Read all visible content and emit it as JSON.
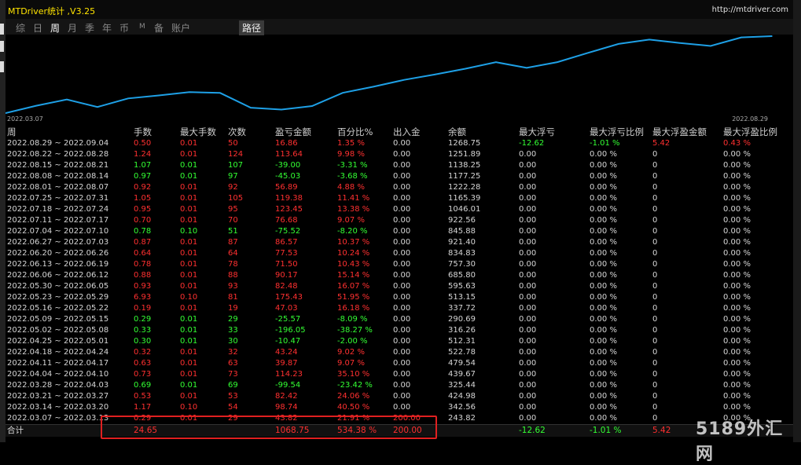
{
  "window": {
    "title": "MTDriver统计 ,V3.25",
    "url": "http://mtdriver.com"
  },
  "toolbar": {
    "tabs": [
      "综",
      "日",
      "周",
      "月",
      "季",
      "年",
      "币",
      "M",
      "备",
      "账户"
    ],
    "active": "周",
    "path_label": "路径"
  },
  "chart_data": {
    "type": "line",
    "x_start_label": "2022.03.07",
    "x_end_label": "2022.08.29",
    "categories": [
      "2022.03.07",
      "2022.03.14",
      "2022.03.21",
      "2022.03.28",
      "2022.04.04",
      "2022.04.11",
      "2022.04.18",
      "2022.04.25",
      "2022.05.02",
      "2022.05.09",
      "2022.05.16",
      "2022.05.23",
      "2022.05.30",
      "2022.06.06",
      "2022.06.13",
      "2022.06.20",
      "2022.06.27",
      "2022.07.04",
      "2022.07.11",
      "2022.07.18",
      "2022.07.25",
      "2022.08.01",
      "2022.08.08",
      "2022.08.15",
      "2022.08.22",
      "2022.08.29"
    ],
    "values": [
      243.82,
      342.56,
      424.98,
      325.44,
      439.67,
      479.54,
      522.78,
      512.31,
      316.26,
      290.69,
      337.72,
      513.15,
      595.63,
      685.8,
      757.3,
      834.83,
      921.4,
      845.88,
      922.56,
      1046.01,
      1165.39,
      1222.28,
      1177.25,
      1138.25,
      1251.89,
      1268.75
    ],
    "line_color": "#1ea0e6"
  },
  "table": {
    "headers": [
      "周",
      "手数",
      "最大手数",
      "次数",
      "盈亏金额",
      "百分比%",
      "出入金",
      "余额",
      "最大浮亏",
      "最大浮亏比例",
      "最大浮盈金额",
      "最大浮盈比例"
    ],
    "rows": [
      {
        "d": "2022.08.29 ~ 2022.09.04",
        "lots": "0.50",
        "maxlot": "0.01",
        "cnt": "50",
        "pl": "16.86",
        "pct": "1.35 %",
        "io": "0.00",
        "bal": "1268.75",
        "mdd": "-12.62",
        "mddp": "-1.01 %",
        "mfe": "5.42",
        "mfep": "0.43 %",
        "t": "p"
      },
      {
        "d": "2022.08.22 ~ 2022.08.28",
        "lots": "1.24",
        "maxlot": "0.01",
        "cnt": "124",
        "pl": "113.64",
        "pct": "9.98 %",
        "io": "0.00",
        "bal": "1251.89",
        "mdd": "0.00",
        "mddp": "0.00 %",
        "mfe": "0",
        "mfep": "0.00 %",
        "t": "p"
      },
      {
        "d": "2022.08.15 ~ 2022.08.21",
        "lots": "1.07",
        "maxlot": "0.01",
        "cnt": "107",
        "pl": "-39.00",
        "pct": "-3.31 %",
        "io": "0.00",
        "bal": "1138.25",
        "mdd": "0.00",
        "mddp": "0.00 %",
        "mfe": "0",
        "mfep": "0.00 %",
        "t": "n"
      },
      {
        "d": "2022.08.08 ~ 2022.08.14",
        "lots": "0.97",
        "maxlot": "0.01",
        "cnt": "97",
        "pl": "-45.03",
        "pct": "-3.68 %",
        "io": "0.00",
        "bal": "1177.25",
        "mdd": "0.00",
        "mddp": "0.00 %",
        "mfe": "0",
        "mfep": "0.00 %",
        "t": "n"
      },
      {
        "d": "2022.08.01 ~ 2022.08.07",
        "lots": "0.92",
        "maxlot": "0.01",
        "cnt": "92",
        "pl": "56.89",
        "pct": "4.88 %",
        "io": "0.00",
        "bal": "1222.28",
        "mdd": "0.00",
        "mddp": "0.00 %",
        "mfe": "0",
        "mfep": "0.00 %",
        "t": "p"
      },
      {
        "d": "2022.07.25 ~ 2022.07.31",
        "lots": "1.05",
        "maxlot": "0.01",
        "cnt": "105",
        "pl": "119.38",
        "pct": "11.41 %",
        "io": "0.00",
        "bal": "1165.39",
        "mdd": "0.00",
        "mddp": "0.00 %",
        "mfe": "0",
        "mfep": "0.00 %",
        "t": "p"
      },
      {
        "d": "2022.07.18 ~ 2022.07.24",
        "lots": "0.95",
        "maxlot": "0.01",
        "cnt": "95",
        "pl": "123.45",
        "pct": "13.38 %",
        "io": "0.00",
        "bal": "1046.01",
        "mdd": "0.00",
        "mddp": "0.00 %",
        "mfe": "0",
        "mfep": "0.00 %",
        "t": "p"
      },
      {
        "d": "2022.07.11 ~ 2022.07.17",
        "lots": "0.70",
        "maxlot": "0.01",
        "cnt": "70",
        "pl": "76.68",
        "pct": "9.07 %",
        "io": "0.00",
        "bal": "922.56",
        "mdd": "0.00",
        "mddp": "0.00 %",
        "mfe": "0",
        "mfep": "0.00 %",
        "t": "p"
      },
      {
        "d": "2022.07.04 ~ 2022.07.10",
        "lots": "0.78",
        "maxlot": "0.10",
        "cnt": "51",
        "pl": "-75.52",
        "pct": "-8.20 %",
        "io": "0.00",
        "bal": "845.88",
        "mdd": "0.00",
        "mddp": "0.00 %",
        "mfe": "0",
        "mfep": "0.00 %",
        "t": "n"
      },
      {
        "d": "2022.06.27 ~ 2022.07.03",
        "lots": "0.87",
        "maxlot": "0.01",
        "cnt": "87",
        "pl": "86.57",
        "pct": "10.37 %",
        "io": "0.00",
        "bal": "921.40",
        "mdd": "0.00",
        "mddp": "0.00 %",
        "mfe": "0",
        "mfep": "0.00 %",
        "t": "p"
      },
      {
        "d": "2022.06.20 ~ 2022.06.26",
        "lots": "0.64",
        "maxlot": "0.01",
        "cnt": "64",
        "pl": "77.53",
        "pct": "10.24 %",
        "io": "0.00",
        "bal": "834.83",
        "mdd": "0.00",
        "mddp": "0.00 %",
        "mfe": "0",
        "mfep": "0.00 %",
        "t": "p"
      },
      {
        "d": "2022.06.13 ~ 2022.06.19",
        "lots": "0.78",
        "maxlot": "0.01",
        "cnt": "78",
        "pl": "71.50",
        "pct": "10.43 %",
        "io": "0.00",
        "bal": "757.30",
        "mdd": "0.00",
        "mddp": "0.00 %",
        "mfe": "0",
        "mfep": "0.00 %",
        "t": "p"
      },
      {
        "d": "2022.06.06 ~ 2022.06.12",
        "lots": "0.88",
        "maxlot": "0.01",
        "cnt": "88",
        "pl": "90.17",
        "pct": "15.14 %",
        "io": "0.00",
        "bal": "685.80",
        "mdd": "0.00",
        "mddp": "0.00 %",
        "mfe": "0",
        "mfep": "0.00 %",
        "t": "p"
      },
      {
        "d": "2022.05.30 ~ 2022.06.05",
        "lots": "0.93",
        "maxlot": "0.01",
        "cnt": "93",
        "pl": "82.48",
        "pct": "16.07 %",
        "io": "0.00",
        "bal": "595.63",
        "mdd": "0.00",
        "mddp": "0.00 %",
        "mfe": "0",
        "mfep": "0.00 %",
        "t": "p"
      },
      {
        "d": "2022.05.23 ~ 2022.05.29",
        "lots": "6.93",
        "maxlot": "0.10",
        "cnt": "81",
        "pl": "175.43",
        "pct": "51.95 %",
        "io": "0.00",
        "bal": "513.15",
        "mdd": "0.00",
        "mddp": "0.00 %",
        "mfe": "0",
        "mfep": "0.00 %",
        "t": "p"
      },
      {
        "d": "2022.05.16 ~ 2022.05.22",
        "lots": "0.19",
        "maxlot": "0.01",
        "cnt": "19",
        "pl": "47.03",
        "pct": "16.18 %",
        "io": "0.00",
        "bal": "337.72",
        "mdd": "0.00",
        "mddp": "0.00 %",
        "mfe": "0",
        "mfep": "0.00 %",
        "t": "p"
      },
      {
        "d": "2022.05.09 ~ 2022.05.15",
        "lots": "0.29",
        "maxlot": "0.01",
        "cnt": "29",
        "pl": "-25.57",
        "pct": "-8.09 %",
        "io": "0.00",
        "bal": "290.69",
        "mdd": "0.00",
        "mddp": "0.00 %",
        "mfe": "0",
        "mfep": "0.00 %",
        "t": "n"
      },
      {
        "d": "2022.05.02 ~ 2022.05.08",
        "lots": "0.33",
        "maxlot": "0.01",
        "cnt": "33",
        "pl": "-196.05",
        "pct": "-38.27 %",
        "io": "0.00",
        "bal": "316.26",
        "mdd": "0.00",
        "mddp": "0.00 %",
        "mfe": "0",
        "mfep": "0.00 %",
        "t": "n"
      },
      {
        "d": "2022.04.25 ~ 2022.05.01",
        "lots": "0.30",
        "maxlot": "0.01",
        "cnt": "30",
        "pl": "-10.47",
        "pct": "-2.00 %",
        "io": "0.00",
        "bal": "512.31",
        "mdd": "0.00",
        "mddp": "0.00 %",
        "mfe": "0",
        "mfep": "0.00 %",
        "t": "n"
      },
      {
        "d": "2022.04.18 ~ 2022.04.24",
        "lots": "0.32",
        "maxlot": "0.01",
        "cnt": "32",
        "pl": "43.24",
        "pct": "9.02 %",
        "io": "0.00",
        "bal": "522.78",
        "mdd": "0.00",
        "mddp": "0.00 %",
        "mfe": "0",
        "mfep": "0.00 %",
        "t": "p"
      },
      {
        "d": "2022.04.11 ~ 2022.04.17",
        "lots": "0.63",
        "maxlot": "0.01",
        "cnt": "63",
        "pl": "39.87",
        "pct": "9.07 %",
        "io": "0.00",
        "bal": "479.54",
        "mdd": "0.00",
        "mddp": "0.00 %",
        "mfe": "0",
        "mfep": "0.00 %",
        "t": "p"
      },
      {
        "d": "2022.04.04 ~ 2022.04.10",
        "lots": "0.73",
        "maxlot": "0.01",
        "cnt": "73",
        "pl": "114.23",
        "pct": "35.10 %",
        "io": "0.00",
        "bal": "439.67",
        "mdd": "0.00",
        "mddp": "0.00 %",
        "mfe": "0",
        "mfep": "0.00 %",
        "t": "p"
      },
      {
        "d": "2022.03.28 ~ 2022.04.03",
        "lots": "0.69",
        "maxlot": "0.01",
        "cnt": "69",
        "pl": "-99.54",
        "pct": "-23.42 %",
        "io": "0.00",
        "bal": "325.44",
        "mdd": "0.00",
        "mddp": "0.00 %",
        "mfe": "0",
        "mfep": "0.00 %",
        "t": "n"
      },
      {
        "d": "2022.03.21 ~ 2022.03.27",
        "lots": "0.53",
        "maxlot": "0.01",
        "cnt": "53",
        "pl": "82.42",
        "pct": "24.06 %",
        "io": "0.00",
        "bal": "424.98",
        "mdd": "0.00",
        "mddp": "0.00 %",
        "mfe": "0",
        "mfep": "0.00 %",
        "t": "p"
      },
      {
        "d": "2022.03.14 ~ 2022.03.20",
        "lots": "1.17",
        "maxlot": "0.10",
        "cnt": "54",
        "pl": "98.74",
        "pct": "40.50 %",
        "io": "0.00",
        "bal": "342.56",
        "mdd": "0.00",
        "mddp": "0.00 %",
        "mfe": "0",
        "mfep": "0.00 %",
        "t": "p"
      },
      {
        "d": "2022.03.07 ~ 2022.03.13",
        "lots": "0.29",
        "maxlot": "0.01",
        "cnt": "29",
        "pl": "43.82",
        "pct": "21.91 %",
        "io": "200.00",
        "bal": "243.82",
        "mdd": "0.00",
        "mddp": "0.00 %",
        "mfe": "0",
        "mfep": "0.00 %",
        "t": "p"
      }
    ],
    "total": {
      "label": "合计",
      "lots": "24.65",
      "pl": "1068.75",
      "pct": "534.38 %",
      "io": "200.00",
      "mdd": "-12.62",
      "mddp": "-1.01 %",
      "mfe": "5.42"
    }
  },
  "colors": {
    "positive": "#ff3030",
    "negative": "#33ff33",
    "title": "#ffe400",
    "highlight": "#e02020"
  },
  "watermark": "5189外汇网"
}
